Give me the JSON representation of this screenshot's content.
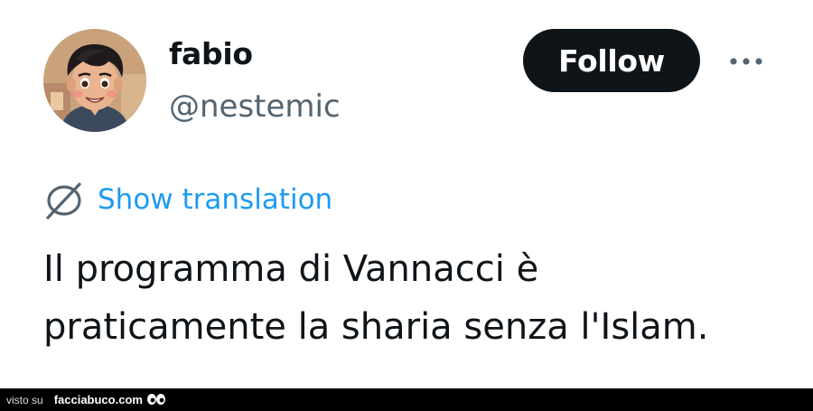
{
  "tweet": {
    "author": {
      "display_name": "fabio",
      "handle": "@nestemic",
      "avatar": "cartoon-avatar"
    },
    "follow_label": "Follow",
    "more_icon": "more-horizontal-icon",
    "translation": {
      "icon": "globe-translate-icon",
      "label": "Show translation"
    },
    "text_lines": [
      "Il programma di Vannacci è",
      "praticamente la sharia senza l'Islam."
    ]
  },
  "footer": {
    "prefix": "visto su",
    "site": "facciabuco.com",
    "logo": "eyes-logo-icon"
  },
  "colors": {
    "text": "#0f1419",
    "secondary": "#536471",
    "accent": "#1d9bf0",
    "follow_bg": "#0f1419"
  }
}
